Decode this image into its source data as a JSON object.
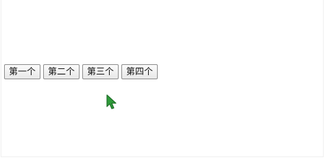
{
  "buttons": [
    {
      "label": "第一个"
    },
    {
      "label": "第二个"
    },
    {
      "label": "第三个"
    },
    {
      "label": "第四个"
    }
  ],
  "cursor": {
    "icon": "cursor-arrow-icon",
    "color": "#2e9b3a",
    "outline": "#1f6f28"
  }
}
